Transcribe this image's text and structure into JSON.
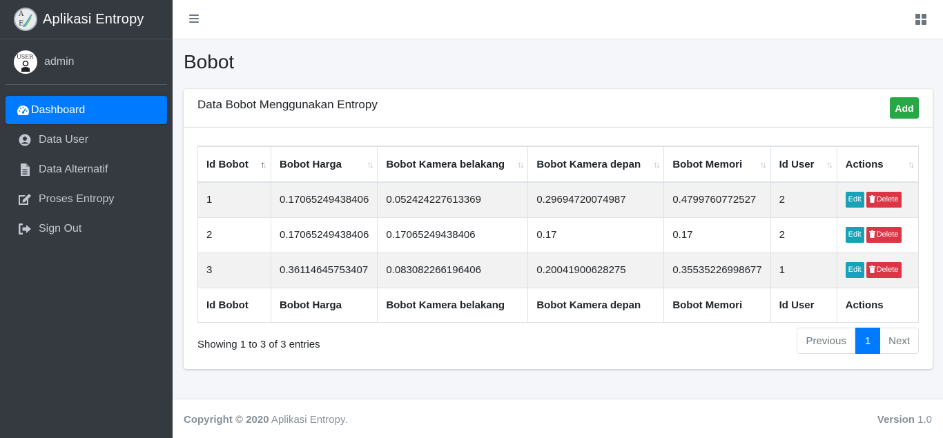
{
  "brand": {
    "name": "Aplikasi Entropy",
    "logo_letter_top": "A",
    "logo_letter_bottom": "E"
  },
  "user": {
    "avatar_text": "USER",
    "name": "admin"
  },
  "sidebar": {
    "items": [
      {
        "label": "Dashboard",
        "icon": "tachometer-icon",
        "active": true
      },
      {
        "label": "Data User",
        "icon": "user-circle-icon"
      },
      {
        "label": "Data Alternatif",
        "icon": "file-icon"
      },
      {
        "label": "Proses Entropy",
        "icon": "edit-icon"
      },
      {
        "label": "Sign Out",
        "icon": "sign-out-icon"
      }
    ]
  },
  "page": {
    "title": "Bobot"
  },
  "card": {
    "title": "Data Bobot Menggunakan Entropy",
    "add_label": "Add"
  },
  "table": {
    "columns": [
      "Id Bobot",
      "Bobot Harga",
      "Bobot Kamera belakang",
      "Bobot Kamera depan",
      "Bobot Memori",
      "Id User",
      "Actions"
    ],
    "rows": [
      [
        "1",
        "0.17065249438406",
        "0.052424227613369",
        "0.29694720074987",
        "0.4799760772527",
        "2"
      ],
      [
        "2",
        "0.17065249438406",
        "0.17065249438406",
        "0.17",
        "0.17",
        "2"
      ],
      [
        "3",
        "0.36114645753407",
        "0.083082266196406",
        "0.20041900628275",
        "0.35535226998677",
        "1"
      ]
    ],
    "edit_label": "Edit",
    "delete_label": "Delete"
  },
  "pagination": {
    "info": "Showing 1 to 3 of 3 entries",
    "previous": "Previous",
    "current": "1",
    "next": "Next"
  },
  "footer": {
    "copyright_bold": "Copyright © 2020",
    "copyright_rest": " Aplikasi Entropy.",
    "version_label": "Version",
    "version_value": " 1.0"
  },
  "colors": {
    "sidebar_bg": "#343a40",
    "active": "#007bff",
    "add": "#28a745",
    "edit": "#17a2b8",
    "delete": "#dc3545"
  }
}
